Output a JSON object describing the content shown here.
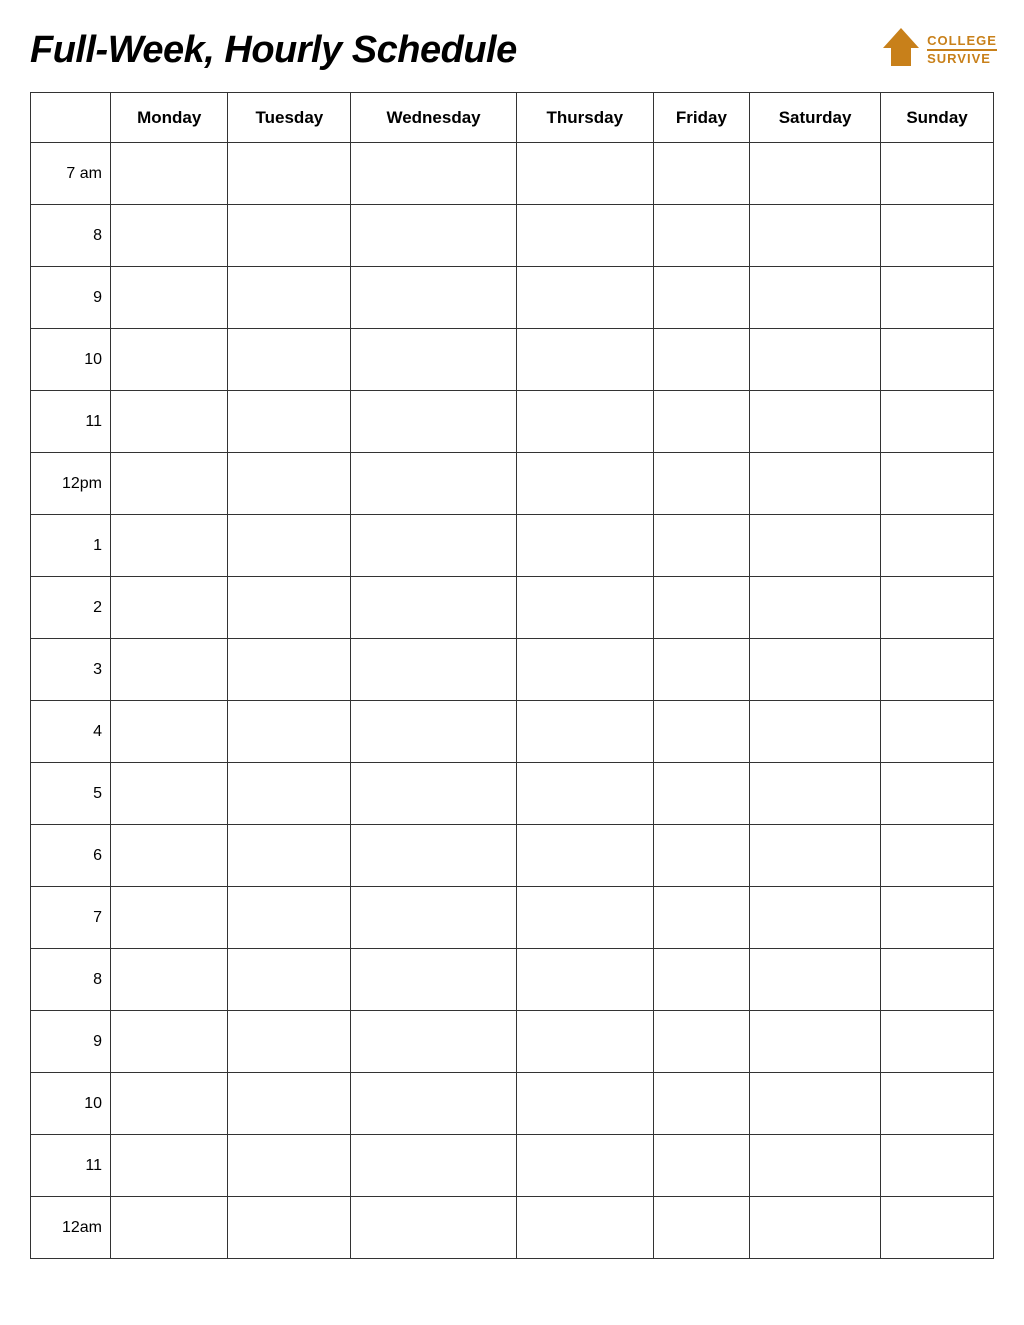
{
  "header": {
    "title": "Full-Week, Hourly Schedule",
    "logo": {
      "line1": "COLLEGE",
      "line2": "SURVIVE"
    }
  },
  "table": {
    "columns": {
      "time_header": "",
      "days": [
        "Monday",
        "Tuesday",
        "Wednesday",
        "Thursday",
        "Friday",
        "Saturday",
        "Sunday"
      ]
    },
    "rows": [
      {
        "time": "7 am"
      },
      {
        "time": "8"
      },
      {
        "time": "9"
      },
      {
        "time": "10"
      },
      {
        "time": "11"
      },
      {
        "time": "12pm"
      },
      {
        "time": "1"
      },
      {
        "time": "2"
      },
      {
        "time": "3"
      },
      {
        "time": "4"
      },
      {
        "time": "5"
      },
      {
        "time": "6"
      },
      {
        "time": "7"
      },
      {
        "time": "8"
      },
      {
        "time": "9"
      },
      {
        "time": "10"
      },
      {
        "time": "11"
      },
      {
        "time": "12am"
      }
    ]
  },
  "colors": {
    "accent": "#c8801a",
    "border": "#333",
    "text": "#000"
  }
}
